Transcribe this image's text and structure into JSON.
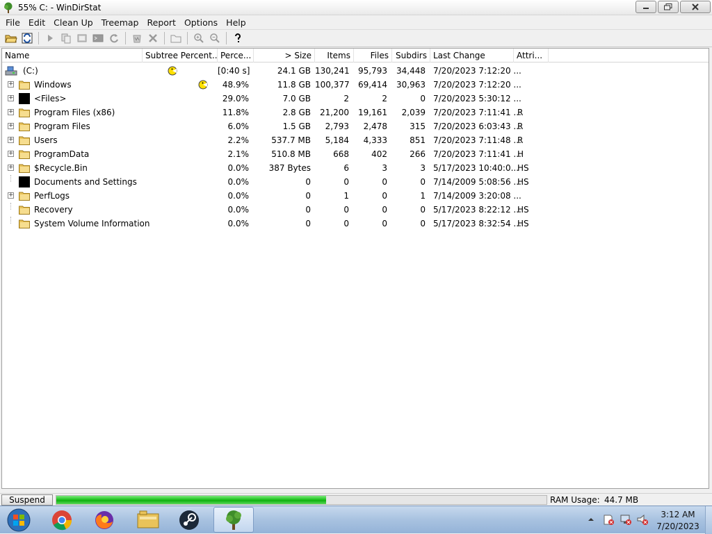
{
  "window": {
    "title": "55% C: - WinDirStat"
  },
  "menu": [
    "File",
    "Edit",
    "Clean Up",
    "Treemap",
    "Report",
    "Options",
    "Help"
  ],
  "columns": {
    "name": "Name",
    "subtree": "Subtree Percent...",
    "percent": "Perce...",
    "size": "> Size",
    "items": "Items",
    "files": "Files",
    "subdirs": "Subdirs",
    "last_change": "Last Change",
    "attrib": "Attri..."
  },
  "root": {
    "name": "(C:)",
    "percent": "[0:40 s]",
    "size": "24.1 GB",
    "items": "130,241",
    "files": "95,793",
    "subdirs": "34,448",
    "last_change": "7/20/2023  7:12:20 ...",
    "attrib": ""
  },
  "rows": [
    {
      "name": "Windows",
      "icon": "folder",
      "expander": true,
      "percent": "48.9%",
      "size": "11.8 GB",
      "items": "100,377",
      "files": "69,414",
      "subdirs": "30,963",
      "last_change": "7/20/2023  7:12:20 ...",
      "attrib": "",
      "busy": true
    },
    {
      "name": "<Files>",
      "icon": "black",
      "expander": true,
      "percent": "29.0%",
      "size": "7.0 GB",
      "items": "2",
      "files": "2",
      "subdirs": "0",
      "last_change": "7/20/2023  5:30:12 ...",
      "attrib": ""
    },
    {
      "name": "Program Files (x86)",
      "icon": "folder",
      "expander": true,
      "percent": "11.8%",
      "size": "2.8 GB",
      "items": "21,200",
      "files": "19,161",
      "subdirs": "2,039",
      "last_change": "7/20/2023  7:11:41 ...",
      "attrib": "R"
    },
    {
      "name": "Program Files",
      "icon": "folder",
      "expander": true,
      "percent": "6.0%",
      "size": "1.5 GB",
      "items": "2,793",
      "files": "2,478",
      "subdirs": "315",
      "last_change": "7/20/2023  6:03:43 ...",
      "attrib": "R"
    },
    {
      "name": "Users",
      "icon": "folder",
      "expander": true,
      "percent": "2.2%",
      "size": "537.7 MB",
      "items": "5,184",
      "files": "4,333",
      "subdirs": "851",
      "last_change": "7/20/2023  7:11:48 ...",
      "attrib": "R"
    },
    {
      "name": "ProgramData",
      "icon": "folder",
      "expander": true,
      "percent": "2.1%",
      "size": "510.8 MB",
      "items": "668",
      "files": "402",
      "subdirs": "266",
      "last_change": "7/20/2023  7:11:41 ...",
      "attrib": "H"
    },
    {
      "name": "$Recycle.Bin",
      "icon": "folder",
      "expander": true,
      "percent": "0.0%",
      "size": "387 Bytes",
      "items": "6",
      "files": "3",
      "subdirs": "3",
      "last_change": "5/17/2023  10:40:0...",
      "attrib": "HS"
    },
    {
      "name": "Documents and Settings",
      "icon": "black",
      "expander": false,
      "percent": "0.0%",
      "size": "0",
      "items": "0",
      "files": "0",
      "subdirs": "0",
      "last_change": "7/14/2009  5:08:56 ...",
      "attrib": "HS"
    },
    {
      "name": "PerfLogs",
      "icon": "folder",
      "expander": true,
      "percent": "0.0%",
      "size": "0",
      "items": "1",
      "files": "0",
      "subdirs": "1",
      "last_change": "7/14/2009  3:20:08 ...",
      "attrib": ""
    },
    {
      "name": "Recovery",
      "icon": "folder",
      "expander": false,
      "percent": "0.0%",
      "size": "0",
      "items": "0",
      "files": "0",
      "subdirs": "0",
      "last_change": "5/17/2023  8:22:12 ...",
      "attrib": "HS"
    },
    {
      "name": "System Volume Information",
      "icon": "folder",
      "expander": false,
      "percent": "0.0%",
      "size": "0",
      "items": "0",
      "files": "0",
      "subdirs": "0",
      "last_change": "5/17/2023  8:32:54 ...",
      "attrib": "HS"
    }
  ],
  "status": {
    "suspend_label": "Suspend",
    "progress_fraction": 0.55,
    "ram_label": "RAM Usage:",
    "ram_value": "44.7 MB"
  },
  "taskbar": {
    "apps": [
      "chrome-icon",
      "firefox-icon",
      "file-explorer-icon",
      "steam-icon",
      "windirstat-icon"
    ],
    "time": "3:12 AM",
    "date": "7/20/2023"
  },
  "colors": {
    "progress": "#22c322",
    "folder": "#e8c25a",
    "pacman": "#ffe000"
  }
}
